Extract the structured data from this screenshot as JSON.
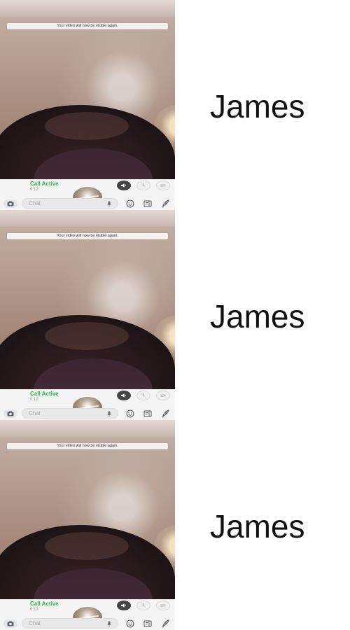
{
  "toast": "Your video will now be visible again.",
  "call": {
    "status": "Call Active",
    "timer": "0:12"
  },
  "chat": {
    "placeholder": "Chat"
  },
  "contact": {
    "name": "James"
  },
  "colors": {
    "status_green": "#2fb34a",
    "active_button": "#444444",
    "inactive_button": "#f0f0f0"
  },
  "icons": [
    "speaker-icon",
    "mute-mic-icon",
    "camera-off-icon",
    "camera-icon",
    "microphone-icon",
    "emoji-icon",
    "sticker-icon",
    "rocket-icon"
  ]
}
